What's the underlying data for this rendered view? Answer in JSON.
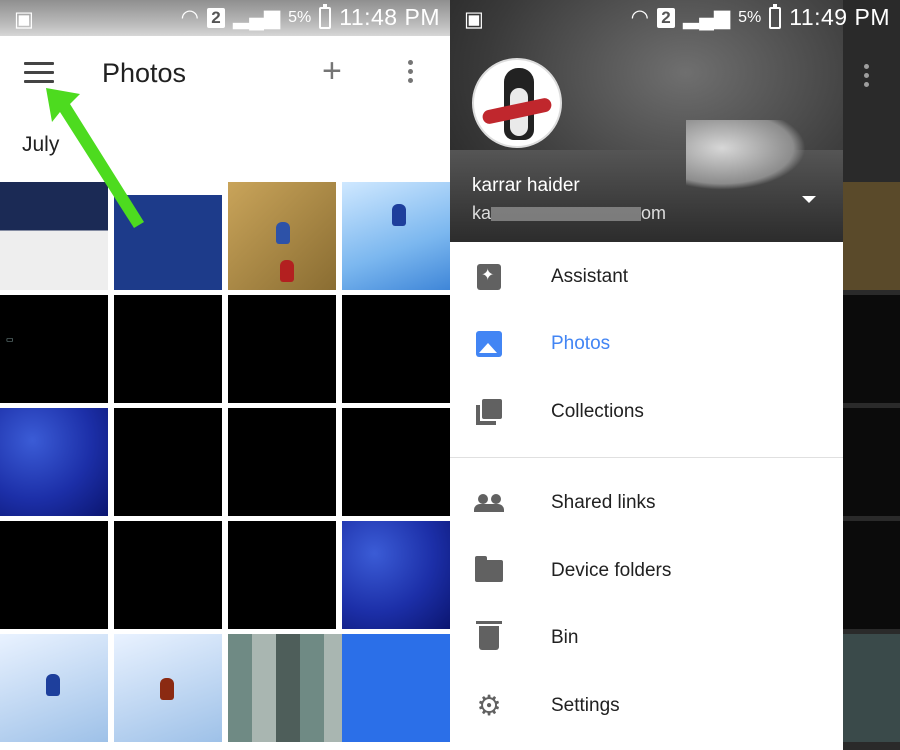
{
  "left": {
    "status": {
      "sim": "2",
      "battery": "5%",
      "time": "11:48 PM"
    },
    "appbar": {
      "title": "Photos"
    },
    "section_label": "July"
  },
  "right": {
    "status": {
      "sim": "2",
      "battery": "5%",
      "time": "11:49 PM"
    },
    "account": {
      "name": "karrar haider",
      "email_visible_prefix": "ka",
      "email_visible_suffix": "om"
    },
    "menu": [
      {
        "label": "Assistant",
        "icon": "assistant-icon",
        "active": false
      },
      {
        "label": "Photos",
        "icon": "photos-icon",
        "active": true
      },
      {
        "label": "Collections",
        "icon": "collections-icon",
        "active": false
      },
      {
        "label": "Shared links",
        "icon": "shared-links-icon",
        "active": false
      },
      {
        "label": "Device folders",
        "icon": "folder-icon",
        "active": false
      },
      {
        "label": "Bin",
        "icon": "bin-icon",
        "active": false
      },
      {
        "label": "Settings",
        "icon": "gear-icon",
        "active": false
      }
    ]
  },
  "colors": {
    "accent": "#4285f4",
    "arrow": "#4ddb1f",
    "icon": "#616161"
  }
}
